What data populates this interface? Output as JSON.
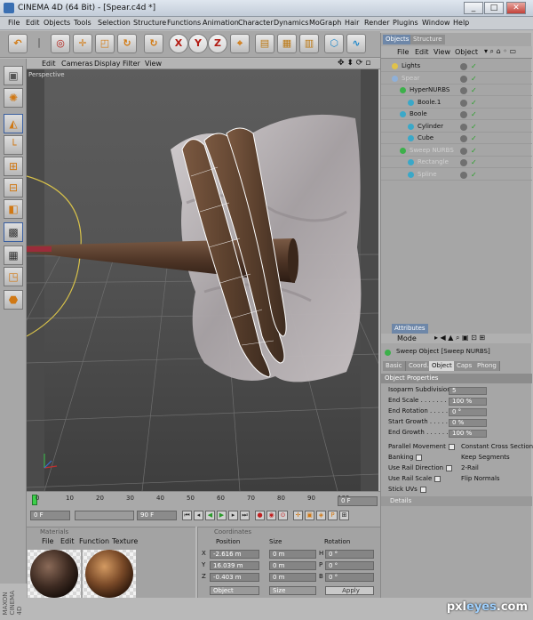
{
  "window": {
    "app": "CINEMA 4D (64 Bit) - [Spear.c4d *]",
    "controls": [
      "_",
      "□",
      "✕"
    ]
  },
  "menu": [
    "File",
    "Edit",
    "Objects",
    "Tools",
    "Selection",
    "Structure",
    "Functions",
    "Animation",
    "Character",
    "Dynamics",
    "MoGraph",
    "Hair",
    "Render",
    "Plugins",
    "Window",
    "Help"
  ],
  "toolbar": {
    "axis_x": "X",
    "axis_y": "Y",
    "axis_z": "Z"
  },
  "viewport": {
    "menu": [
      "Edit",
      "Cameras",
      "Display",
      "Filter",
      "View"
    ],
    "label": "Perspective"
  },
  "objects": {
    "tabs": [
      "Objects",
      "Structure"
    ],
    "menu": [
      "File",
      "Edit",
      "View",
      "Object"
    ],
    "rows": [
      {
        "name": "Lights",
        "level": 0,
        "dim": false
      },
      {
        "name": "Spear",
        "level": 0,
        "dim": true
      },
      {
        "name": "HyperNURBS",
        "level": 1,
        "dim": false
      },
      {
        "name": "Boole.1",
        "level": 2,
        "dim": false
      },
      {
        "name": "Boole",
        "level": 1,
        "dim": false
      },
      {
        "name": "Cylinder",
        "level": 2,
        "dim": false
      },
      {
        "name": "Cube",
        "level": 2,
        "dim": false
      },
      {
        "name": "Sweep NURBS",
        "level": 1,
        "dim": true
      },
      {
        "name": "Rectangle",
        "level": 2,
        "dim": true
      },
      {
        "name": "Spline",
        "level": 2,
        "dim": true
      }
    ]
  },
  "attributes": {
    "tab": "Attributes",
    "mode": "Mode",
    "object_title": "Sweep Object [Sweep NURBS]",
    "tabs": [
      "Basic",
      "Coord.",
      "Object",
      "Caps",
      "Phong"
    ],
    "section": "Object Properties",
    "fields": [
      {
        "label": "Isoparm Subdivision",
        "value": "5"
      },
      {
        "label": "End Scale . . . . . . . .",
        "value": "100 %"
      },
      {
        "label": "End Rotation . . . . . .",
        "value": "0 °"
      },
      {
        "label": "Start Growth . . . . . .",
        "value": "0 %"
      },
      {
        "label": "End Growth . . . . . . .",
        "value": "100 %"
      }
    ],
    "checks_left": [
      "Parallel Movement",
      "Banking",
      "Use Rail Direction",
      "Use Rail Scale",
      "Stick UVs"
    ],
    "checks_right": [
      "Constant Cross Section",
      "Keep Segments",
      "2-Rail",
      "Flip Normals"
    ],
    "details": "Details"
  },
  "timeline": {
    "ticks": [
      "0",
      "10",
      "20",
      "30",
      "40",
      "50",
      "60",
      "70",
      "80",
      "90",
      "100"
    ],
    "current": "0 F",
    "start": "0 F",
    "end": "90 F",
    "right": "0 F"
  },
  "materials": {
    "title": "Materials",
    "menu": [
      "File",
      "Edit",
      "Function",
      "Texture"
    ]
  },
  "coordinates": {
    "title": "Coordinates",
    "headers": [
      "Position",
      "Size",
      "Rotation"
    ],
    "rows": [
      {
        "axis": "X",
        "pos": "-2.616 m",
        "size": "0 m",
        "rot_label": "H",
        "rot": "0 °"
      },
      {
        "axis": "Y",
        "pos": "16.039 m",
        "size": "0 m",
        "rot_label": "P",
        "rot": "0 °"
      },
      {
        "axis": "Z",
        "pos": "-0.403 m",
        "size": "0 m",
        "rot_label": "B",
        "rot": "0 °"
      }
    ],
    "mode": "Object",
    "size_mode": "Size",
    "apply": "Apply"
  },
  "brand": "MAXON CINEMA 4D",
  "watermark": {
    "a": "pxl",
    "b": "eyes",
    "c": ".com"
  }
}
